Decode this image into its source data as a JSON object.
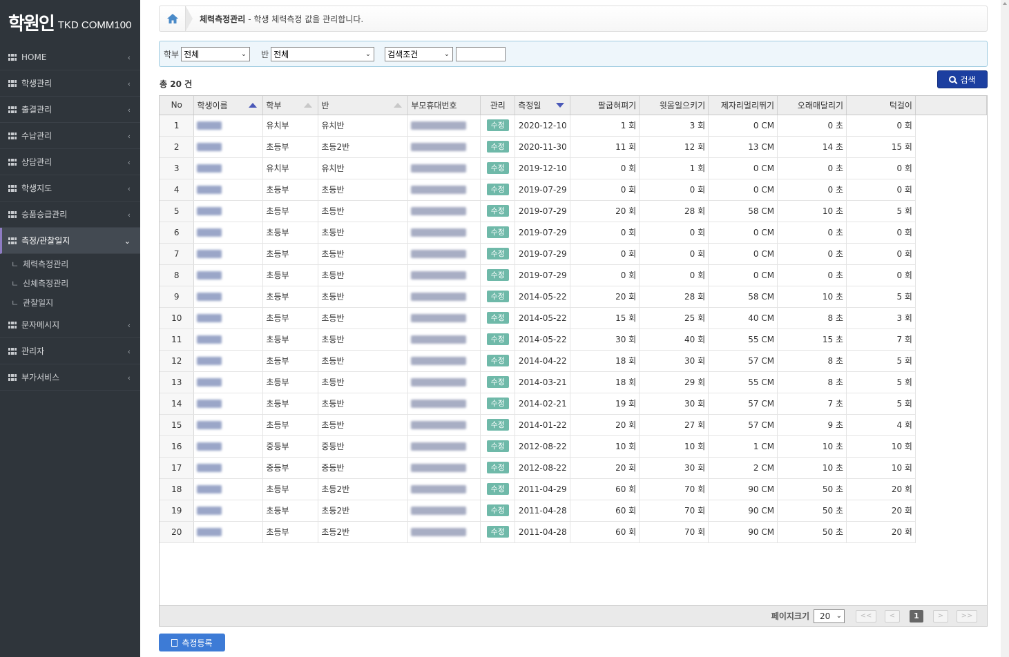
{
  "logo": {
    "mark": "학원인",
    "sub": "TKD COMM100"
  },
  "sidebar": {
    "items": [
      {
        "label": "HOME",
        "name": "home"
      },
      {
        "label": "학생관리",
        "name": "student-management"
      },
      {
        "label": "출결관리",
        "name": "attendance-management"
      },
      {
        "label": "수납관리",
        "name": "payment-management"
      },
      {
        "label": "상담관리",
        "name": "consultation-management"
      },
      {
        "label": "학생지도",
        "name": "student-guidance"
      },
      {
        "label": "승품승급관리",
        "name": "promotion-management"
      },
      {
        "label": "측정/관찰일지",
        "name": "measurement-journal",
        "active": true
      },
      {
        "label": "문자메시지",
        "name": "text-message"
      },
      {
        "label": "관리자",
        "name": "administrator"
      },
      {
        "label": "부가서비스",
        "name": "additional-services"
      }
    ],
    "submenu": [
      {
        "label": "체력측정관리"
      },
      {
        "label": "신체측정관리"
      },
      {
        "label": "관찰일지"
      }
    ],
    "tick": "ㄴ"
  },
  "breadcrumb": {
    "title": "체력측정관리",
    "desc": "- 학생 체력측정 값을 관리합니다."
  },
  "filter": {
    "dept_label": "학부",
    "dept_value": "전체",
    "class_label": "반",
    "class_value": "전체",
    "cond_value": "검색조건",
    "search_text": ""
  },
  "total": "총 20 건",
  "search_button": "검색",
  "columns": [
    "No",
    "학생이름",
    "학부",
    "반",
    "부모휴대번호",
    "관리",
    "측정일",
    "팔굽혀펴기",
    "윗몸일으키기",
    "제자리멀리뛰기",
    "오래매달리기",
    "턱걸이"
  ],
  "edit_label": "수정",
  "rows": [
    {
      "no": "1",
      "dept": "유치부",
      "cls": "유치반",
      "date": "2020-12-10",
      "pushup": "1 회",
      "situp": "3 회",
      "jump": "0 CM",
      "hang": "0 초",
      "pullup": "0 회"
    },
    {
      "no": "2",
      "dept": "초등부",
      "cls": "초등2반",
      "date": "2020-11-30",
      "pushup": "11 회",
      "situp": "12 회",
      "jump": "13 CM",
      "hang": "14 초",
      "pullup": "15 회"
    },
    {
      "no": "3",
      "dept": "유치부",
      "cls": "유치반",
      "date": "2019-12-10",
      "pushup": "0 회",
      "situp": "1 회",
      "jump": "0 CM",
      "hang": "0 초",
      "pullup": "0 회"
    },
    {
      "no": "4",
      "dept": "초등부",
      "cls": "초등반",
      "date": "2019-07-29",
      "pushup": "0 회",
      "situp": "0 회",
      "jump": "0 CM",
      "hang": "0 초",
      "pullup": "0 회"
    },
    {
      "no": "5",
      "dept": "초등부",
      "cls": "초등반",
      "date": "2019-07-29",
      "pushup": "20 회",
      "situp": "28 회",
      "jump": "58 CM",
      "hang": "10 초",
      "pullup": "5 회"
    },
    {
      "no": "6",
      "dept": "초등부",
      "cls": "초등반",
      "date": "2019-07-29",
      "pushup": "0 회",
      "situp": "0 회",
      "jump": "0 CM",
      "hang": "0 초",
      "pullup": "0 회"
    },
    {
      "no": "7",
      "dept": "초등부",
      "cls": "초등반",
      "date": "2019-07-29",
      "pushup": "0 회",
      "situp": "0 회",
      "jump": "0 CM",
      "hang": "0 초",
      "pullup": "0 회"
    },
    {
      "no": "8",
      "dept": "초등부",
      "cls": "초등반",
      "date": "2019-07-29",
      "pushup": "0 회",
      "situp": "0 회",
      "jump": "0 CM",
      "hang": "0 초",
      "pullup": "0 회"
    },
    {
      "no": "9",
      "dept": "초등부",
      "cls": "초등반",
      "date": "2014-05-22",
      "pushup": "20 회",
      "situp": "28 회",
      "jump": "58 CM",
      "hang": "10 초",
      "pullup": "5 회"
    },
    {
      "no": "10",
      "dept": "초등부",
      "cls": "초등반",
      "date": "2014-05-22",
      "pushup": "15 회",
      "situp": "25 회",
      "jump": "40 CM",
      "hang": "8 초",
      "pullup": "3 회"
    },
    {
      "no": "11",
      "dept": "초등부",
      "cls": "초등반",
      "date": "2014-05-22",
      "pushup": "30 회",
      "situp": "40 회",
      "jump": "55 CM",
      "hang": "15 초",
      "pullup": "7 회"
    },
    {
      "no": "12",
      "dept": "초등부",
      "cls": "초등반",
      "date": "2014-04-22",
      "pushup": "18 회",
      "situp": "30 회",
      "jump": "57 CM",
      "hang": "8 초",
      "pullup": "5 회"
    },
    {
      "no": "13",
      "dept": "초등부",
      "cls": "초등반",
      "date": "2014-03-21",
      "pushup": "18 회",
      "situp": "29 회",
      "jump": "55 CM",
      "hang": "8 초",
      "pullup": "5 회"
    },
    {
      "no": "14",
      "dept": "초등부",
      "cls": "초등반",
      "date": "2014-02-21",
      "pushup": "19 회",
      "situp": "30 회",
      "jump": "57 CM",
      "hang": "7 초",
      "pullup": "5 회"
    },
    {
      "no": "15",
      "dept": "초등부",
      "cls": "초등반",
      "date": "2014-01-22",
      "pushup": "20 회",
      "situp": "27 회",
      "jump": "57 CM",
      "hang": "9 초",
      "pullup": "4 회"
    },
    {
      "no": "16",
      "dept": "중등부",
      "cls": "중등반",
      "date": "2012-08-22",
      "pushup": "10 회",
      "situp": "10 회",
      "jump": "1 CM",
      "hang": "10 초",
      "pullup": "10 회"
    },
    {
      "no": "17",
      "dept": "중등부",
      "cls": "중등반",
      "date": "2012-08-22",
      "pushup": "20 회",
      "situp": "30 회",
      "jump": "2 CM",
      "hang": "10 초",
      "pullup": "10 회"
    },
    {
      "no": "18",
      "dept": "초등부",
      "cls": "초등2반",
      "date": "2011-04-29",
      "pushup": "60 회",
      "situp": "70 회",
      "jump": "90 CM",
      "hang": "50 초",
      "pullup": "20 회"
    },
    {
      "no": "19",
      "dept": "초등부",
      "cls": "초등2반",
      "date": "2011-04-28",
      "pushup": "60 회",
      "situp": "70 회",
      "jump": "90 CM",
      "hang": "50 초",
      "pullup": "20 회"
    },
    {
      "no": "20",
      "dept": "초등부",
      "cls": "초등2반",
      "date": "2011-04-28",
      "pushup": "60 회",
      "situp": "70 회",
      "jump": "90 CM",
      "hang": "50 초",
      "pullup": "20 회"
    }
  ],
  "pager": {
    "size_label": "페이지크기",
    "size_value": "20",
    "current_page": "1",
    "first": "<<",
    "prev": "<",
    "next": ">",
    "last": ">>"
  },
  "register_button": "측정등록",
  "colors": {
    "sidebar_bg": "#2f353b",
    "active_accent": "#8e7cc3",
    "search_btn": "#1c3fa0",
    "edit_btn": "#6fb9a9",
    "register_btn": "#3d7bd6"
  }
}
